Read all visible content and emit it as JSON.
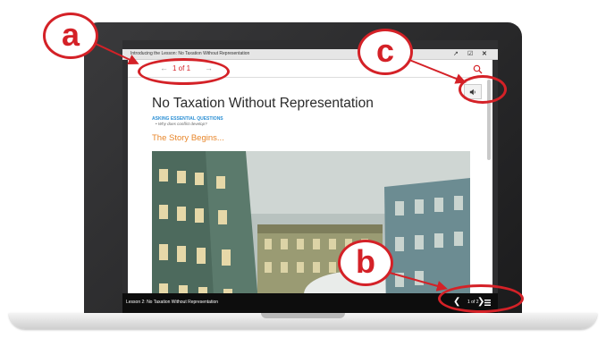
{
  "window": {
    "title": "Introducing the Lesson: No Taxation Without Representation",
    "icons": [
      "external-link-icon",
      "checkbox-icon",
      "close-icon"
    ]
  },
  "nav": {
    "prev_label": "←",
    "page_indicator": "1 of 1",
    "next_label": "→"
  },
  "content": {
    "title": "No Taxation Without Representation",
    "essential_questions_heading": "ASKING ESSENTIAL QUESTIONS",
    "essential_questions": [
      "Why does conflict develop?"
    ],
    "section_heading": "The Story Begins..."
  },
  "footer": {
    "lesson_title": "Lesson 2: No Taxation Without Representation",
    "prev_label": "❮",
    "page_indicator": "1 of 2",
    "next_label": "❯"
  },
  "annotations": {
    "a": "a",
    "b": "b",
    "c": "c"
  },
  "colors": {
    "accent_red": "#d42127",
    "heading_orange": "#e8862a",
    "link_blue": "#2b8fd4",
    "footer_bg": "#0d0d0d"
  }
}
